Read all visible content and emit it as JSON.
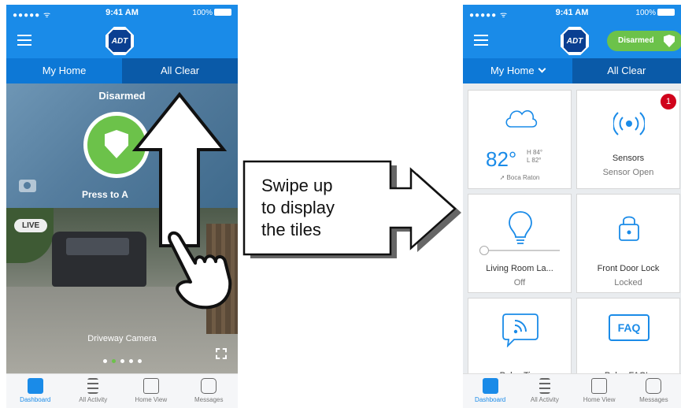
{
  "left_phone": {
    "status_bar": {
      "carrier": "●●●●● ᯤ",
      "time": "9:41 AM",
      "battery": "100%"
    },
    "tabs": {
      "home": "My Home",
      "status": "All Clear"
    },
    "hero": {
      "status": "Disarmed",
      "arm_label": "Press to A"
    },
    "camera": {
      "live": "LIVE",
      "caption": "Driveway Camera"
    },
    "tab_bar": [
      "Dashboard",
      "All Activity",
      "Home View",
      "Messages"
    ]
  },
  "right_phone": {
    "status_bar": {
      "carrier": "●●●●● ᯤ",
      "time": "9:41 AM",
      "battery": "100%"
    },
    "pill": "Disarmed",
    "tabs": {
      "home": "My Home",
      "status": "All Clear"
    },
    "tiles": {
      "weather": {
        "temp": "82°",
        "high": "H 84°",
        "low": "L 82°",
        "location": "➚ Boca Raton"
      },
      "sensors": {
        "title": "Sensors",
        "sub": "Sensor Open",
        "badge": "1"
      },
      "light": {
        "title": "Living Room La...",
        "sub": "Off"
      },
      "lock": {
        "title": "Front Door Lock",
        "sub": "Locked"
      },
      "tips": {
        "title": "Pulse Tips"
      },
      "faq": {
        "title": "Pulse FAQ's",
        "icon_text": "FAQ"
      }
    },
    "tab_bar": [
      "Dashboard",
      "All Activity",
      "Home View",
      "Messages"
    ]
  },
  "logo_text": "ADT",
  "callout": {
    "line1": "Swipe up",
    "line2": "to display",
    "line3": "the tiles"
  },
  "colors": {
    "brand_blue": "#1a8be8",
    "tab_dark": "#0a5aa8",
    "green": "#6cc24a",
    "badge_red": "#d0021b"
  }
}
